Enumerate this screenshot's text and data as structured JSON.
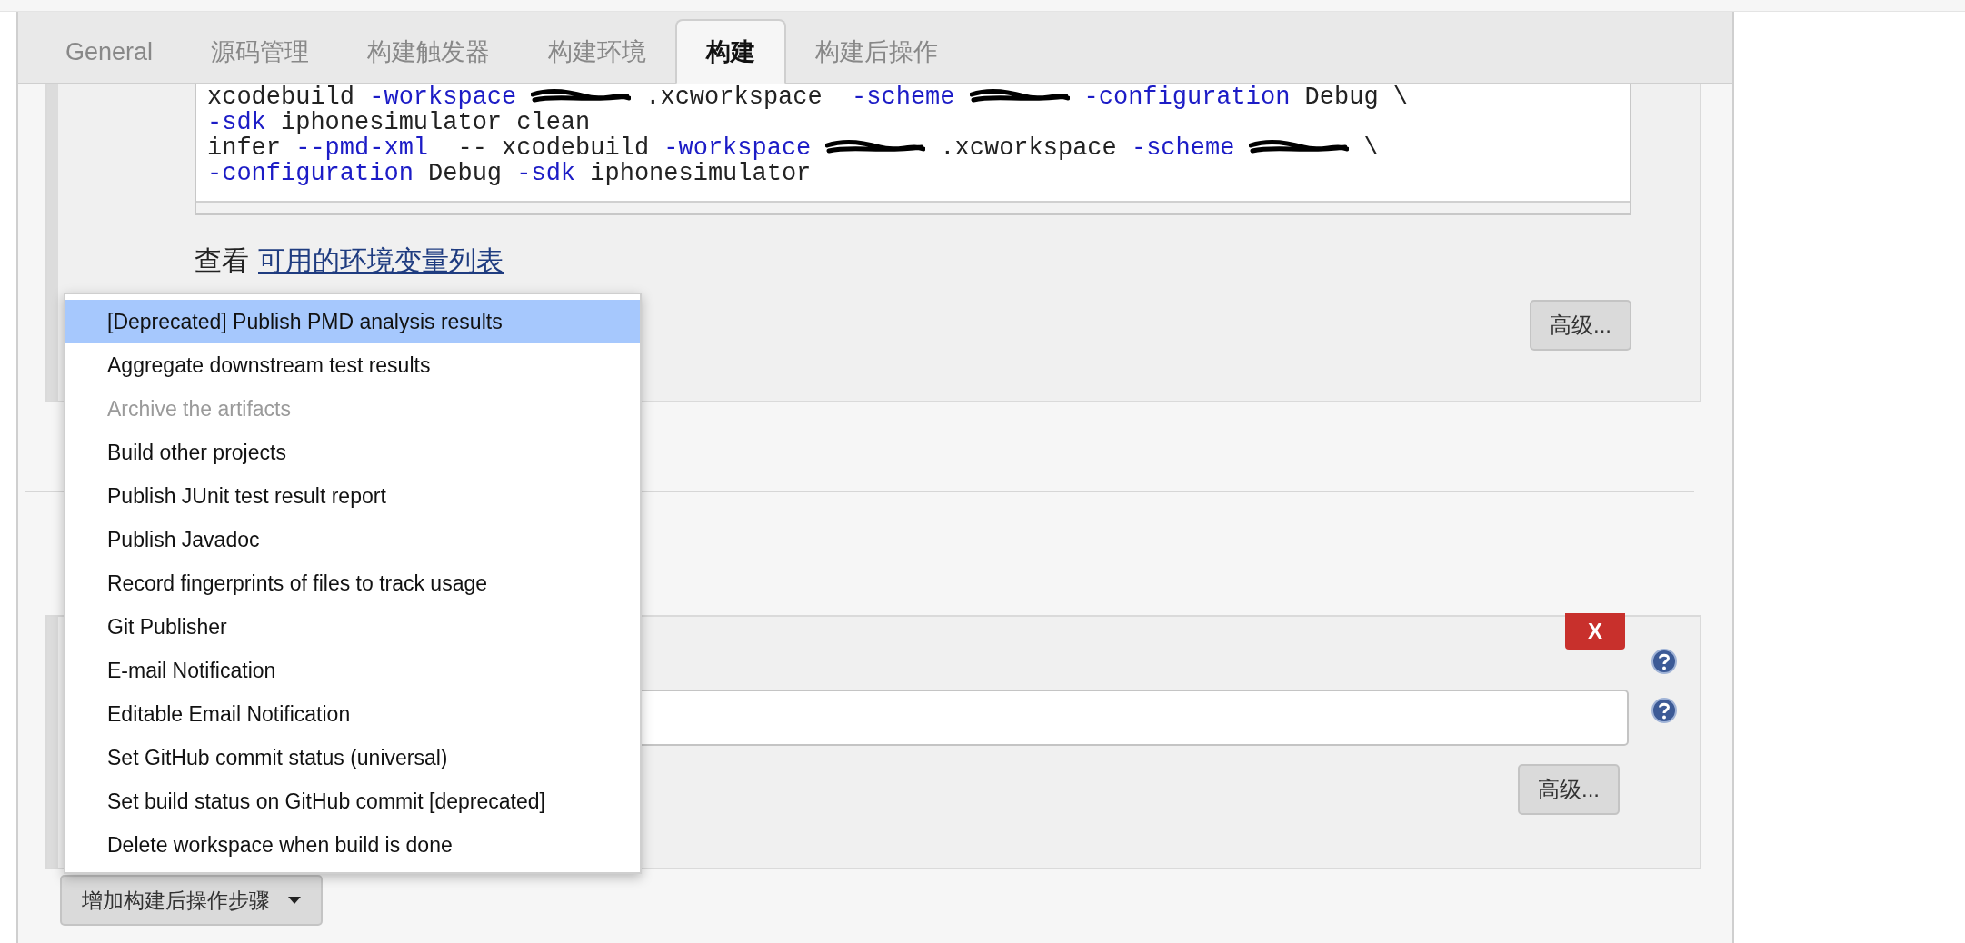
{
  "tabs": [
    {
      "label": "General",
      "selected": false
    },
    {
      "label": "源码管理",
      "selected": false
    },
    {
      "label": "构建触发器",
      "selected": false
    },
    {
      "label": "构建环境",
      "selected": false
    },
    {
      "label": "构建",
      "selected": true
    },
    {
      "label": "构建后操作",
      "selected": false
    }
  ],
  "code_lines": [
    [
      {
        "kind": "text",
        "text": "xcodebuild "
      },
      {
        "kind": "flag",
        "text": "-workspace"
      },
      {
        "kind": "redacted"
      },
      {
        "kind": "text",
        "text": ".xcworkspace  "
      },
      {
        "kind": "flag",
        "text": "-scheme"
      },
      {
        "kind": "redacted"
      },
      {
        "kind": "flag",
        "text": "-configuration"
      },
      {
        "kind": "text",
        "text": " Debug \\"
      }
    ],
    [
      {
        "kind": "flag",
        "text": "-sdk"
      },
      {
        "kind": "text",
        "text": " iphonesimulator clean"
      }
    ],
    [
      {
        "kind": "text",
        "text": "infer "
      },
      {
        "kind": "flag",
        "text": "--pmd-xml"
      },
      {
        "kind": "text",
        "text": "  -- xcodebuild "
      },
      {
        "kind": "flag",
        "text": "-workspace"
      },
      {
        "kind": "redacted"
      },
      {
        "kind": "text",
        "text": ".xcworkspace "
      },
      {
        "kind": "flag",
        "text": "-scheme"
      },
      {
        "kind": "redacted"
      },
      {
        "kind": "text",
        "text": "\\"
      }
    ],
    [
      {
        "kind": "flag",
        "text": "-configuration"
      },
      {
        "kind": "text",
        "text": " Debug "
      },
      {
        "kind": "flag",
        "text": "-sdk"
      },
      {
        "kind": "text",
        "text": " iphonesimulator"
      }
    ]
  ],
  "env_hint": {
    "prefix": "查看",
    "link": "可用的环境变量列表"
  },
  "build_advanced_button": "高级...",
  "publisher": {
    "delete_button": "X",
    "advanced_button": "高级..."
  },
  "add_step_button": "增加构建后操作步骤",
  "dropdown": {
    "items": [
      {
        "label": "[Deprecated] Publish PMD analysis results",
        "selected": true,
        "disabled": false
      },
      {
        "label": "Aggregate downstream test results",
        "selected": false,
        "disabled": false
      },
      {
        "label": "Archive the artifacts",
        "selected": false,
        "disabled": true
      },
      {
        "label": "Build other projects",
        "selected": false,
        "disabled": false
      },
      {
        "label": "Publish JUnit test result report",
        "selected": false,
        "disabled": false
      },
      {
        "label": "Publish Javadoc",
        "selected": false,
        "disabled": false
      },
      {
        "label": "Record fingerprints of files to track usage",
        "selected": false,
        "disabled": false
      },
      {
        "label": "Git Publisher",
        "selected": false,
        "disabled": false
      },
      {
        "label": "E-mail Notification",
        "selected": false,
        "disabled": false
      },
      {
        "label": "Editable Email Notification",
        "selected": false,
        "disabled": false
      },
      {
        "label": "Set GitHub commit status (universal)",
        "selected": false,
        "disabled": false
      },
      {
        "label": "Set build status on GitHub commit [deprecated]",
        "selected": false,
        "disabled": false
      },
      {
        "label": "Delete workspace when build is done",
        "selected": false,
        "disabled": false
      }
    ]
  }
}
